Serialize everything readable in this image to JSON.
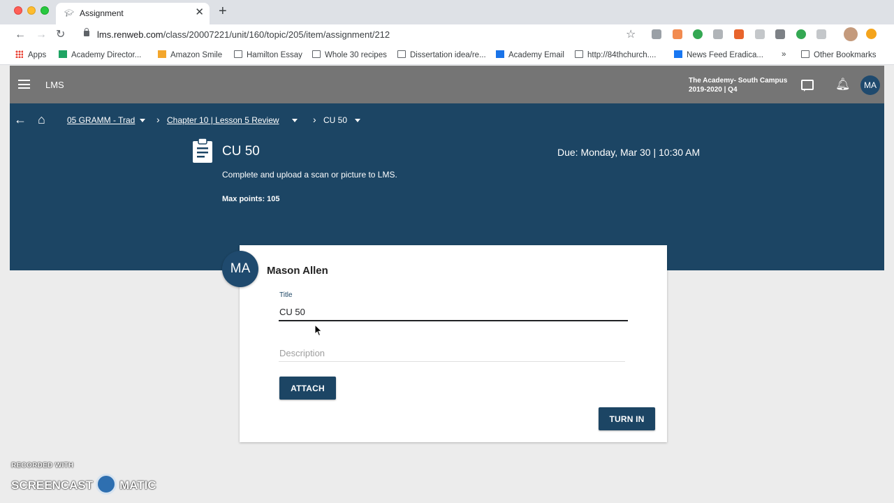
{
  "browser": {
    "tab_title": "Assignment",
    "url_host": "lms.renweb.com",
    "url_path": "/class/20007221/unit/160/topic/205/item/assignment/212",
    "bookmarks": [
      {
        "label": "Apps"
      },
      {
        "label": "Academy Director..."
      },
      {
        "label": "Amazon Smile"
      },
      {
        "label": "Hamilton Essay"
      },
      {
        "label": "Whole 30 recipes"
      },
      {
        "label": "Dissertation idea/re..."
      },
      {
        "label": "Academy Email"
      },
      {
        "label": "http://84thchurch...."
      },
      {
        "label": "News Feed Eradica..."
      }
    ],
    "overflow": "»",
    "other_bookmarks": "Other Bookmarks"
  },
  "appbar": {
    "title": "LMS",
    "school_line1": "The Academy- South Campus",
    "school_line2": "2019-2020 | Q4",
    "user_initials": "MA"
  },
  "breadcrumb": {
    "items": [
      "05 GRAMM - Trad",
      "Chapter 10 | Lesson 5 Review",
      "CU 50"
    ]
  },
  "assignment": {
    "title": "CU 50",
    "due": "Due: Monday, Mar 30 | 10:30 AM",
    "instructions": "Complete and upload a scan or picture to LMS.",
    "max_points": "Max points: 105"
  },
  "submission": {
    "avatar_initials": "MA",
    "student_name": "Mason Allen",
    "title_label": "Title",
    "title_value": "CU 50",
    "description_placeholder": "Description",
    "attach_label": "ATTACH",
    "turn_in_label": "TURN IN"
  },
  "watermark": {
    "line1": "RECORDED WITH",
    "line2_left": "SCREENCAST",
    "line2_right": "MATIC"
  },
  "colors": {
    "header_blue": "#1c4564",
    "appbar_gray": "#757575",
    "avatar_blue": "#1f4a6e"
  }
}
